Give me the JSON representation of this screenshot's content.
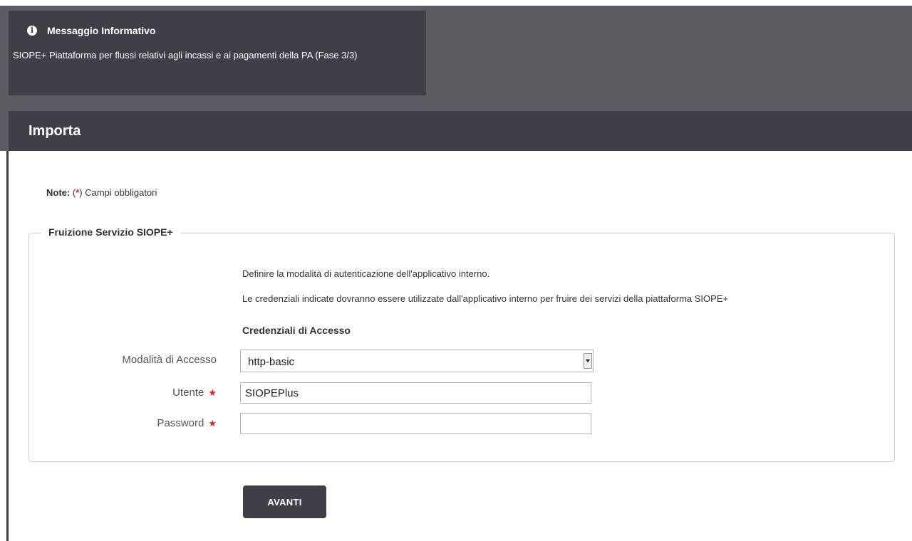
{
  "info": {
    "title": "Messaggio Informativo",
    "text": "SIOPE+ Piattaforma per flussi relativi agli incassi e ai pagamenti della PA (Fase 3/3)"
  },
  "page": {
    "title": "Importa"
  },
  "note": {
    "label": "Note:",
    "open": "(",
    "star": "*",
    "close": ")",
    "text": "Campi obbligatori"
  },
  "fieldset": {
    "legend": "Fruizione Servizio SIOPE+",
    "description1": "Definire la modalità di autenticazione dell'applicativo interno.",
    "description2": "Le credenziali indicate dovranno essere utilizzate dall'applicativo interno per fruire dei servizi della piattaforma SIOPE+",
    "section_title": "Credenziali di Accesso"
  },
  "form": {
    "mode_label": "Modalità di Accesso",
    "mode_value": "http-basic",
    "user_label": "Utente",
    "user_value": "SIOPEPlus",
    "password_label": "Password",
    "password_value": "",
    "required_mark": "★"
  },
  "actions": {
    "next_label": "AVANTI"
  },
  "colors": {
    "dark": "#3f4047",
    "band": "#5b5b60",
    "required": "#d9261c"
  }
}
